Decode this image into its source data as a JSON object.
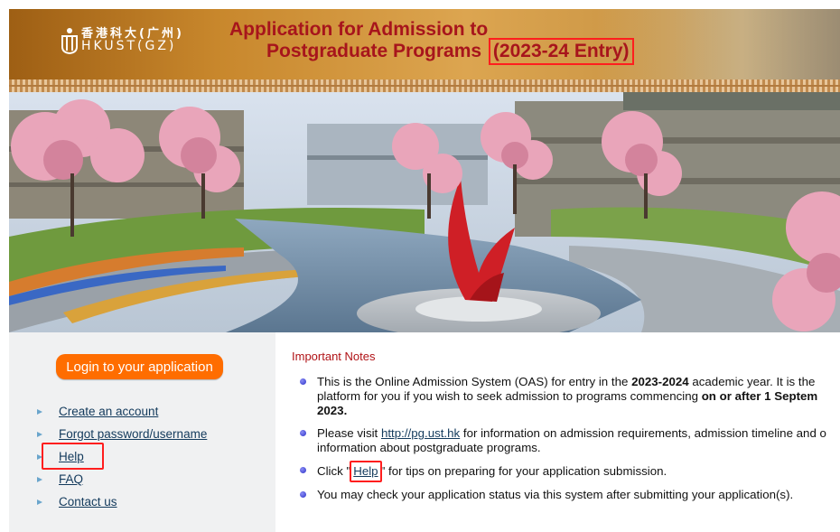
{
  "banner": {
    "logo_cn": "香港科大(广州)",
    "logo_en": "HKUST(GZ)",
    "title_line1": "Application for Admission to",
    "title_line2": "Postgraduate Programs",
    "entry": "(2023-24 Entry)",
    "title_color": "#a7151c",
    "highlight_color": "#ff1e1e"
  },
  "sidebar": {
    "login_button": "Login to your application",
    "login_button_color": "#ff6d00",
    "links": [
      "Create an account",
      "Forgot password/username",
      "Help",
      "FAQ",
      "Contact us"
    ]
  },
  "notes": {
    "heading": "Important Notes",
    "item1": {
      "part1": "This is the Online Admission System (OAS) for entry in the ",
      "year": "2023-2024",
      "part2": " academic year. It is the ",
      "part3": "platform for you if you wish to seek admission to programs commencing ",
      "date": "on or after 1 Septem",
      "date2": "2023."
    },
    "item2": {
      "part1": "Please visit ",
      "link": "http://pg.ust.hk",
      "part2": " for information on admission requirements, admission timeline and o",
      "part3": "information about postgraduate programs."
    },
    "item3": {
      "part1": "Click \"",
      "link": "Help",
      "part2": "\" for tips on preparing for your application submission."
    },
    "item4": "You may check your application status via this system after submitting your application(s)."
  }
}
